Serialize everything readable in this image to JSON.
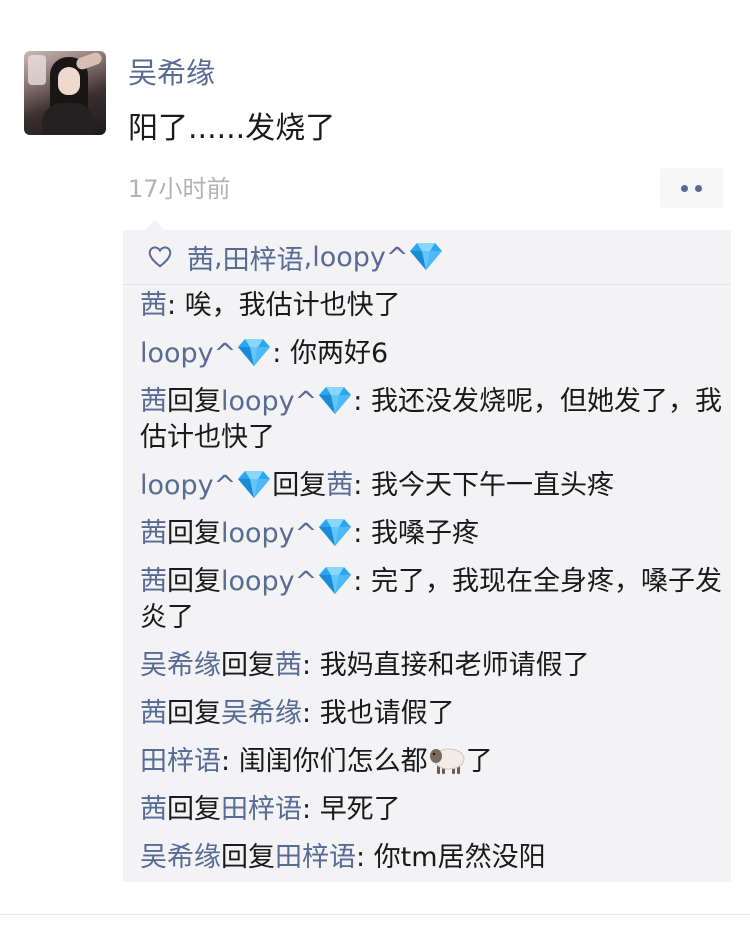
{
  "post": {
    "author": "吴希缘",
    "text": "阳了......发烧了",
    "time": "17小时前",
    "avatar_icon": "user-avatar-photo",
    "more_icon": "more-dots-icon"
  },
  "likes": {
    "icon": "heart-outline-icon",
    "names": [
      "茜",
      "田梓语",
      "loopy^"
    ],
    "separator": ", ",
    "badge_icon": "diamond-emoji"
  },
  "comments": [
    {
      "from": "茜",
      "to": "",
      "text": "唉，我估计也快了",
      "from_badge": false,
      "to_badge": false
    },
    {
      "from": "loopy^",
      "to": "",
      "text": "你两好6",
      "from_badge": true,
      "to_badge": false
    },
    {
      "from": "茜",
      "to": "loopy^",
      "text": "我还没发烧呢，但她发了，我估计也快了",
      "from_badge": false,
      "to_badge": true
    },
    {
      "from": "loopy^",
      "to": "茜",
      "text": "我今天下午一直头疼",
      "from_badge": true,
      "to_badge": false
    },
    {
      "from": "茜",
      "to": "loopy^",
      "text": "我嗓子疼",
      "from_badge": false,
      "to_badge": true
    },
    {
      "from": "茜",
      "to": "loopy^",
      "text": "完了，我现在全身疼，嗓子发炎了",
      "from_badge": false,
      "to_badge": true
    },
    {
      "from": "吴希缘",
      "to": "茜",
      "text": "我妈直接和老师请假了",
      "from_badge": false,
      "to_badge": false
    },
    {
      "from": "茜",
      "to": "吴希缘",
      "text": "我也请假了",
      "from_badge": false,
      "to_badge": false
    },
    {
      "from": "田梓语",
      "to": "",
      "text": "闺闺你们怎么都",
      "text_after": "了",
      "emoji": "sheep-emoji",
      "from_badge": false,
      "to_badge": false
    },
    {
      "from": "茜",
      "to": "田梓语",
      "text": "早死了",
      "from_badge": false,
      "to_badge": false
    },
    {
      "from": "吴希缘",
      "to": "田梓语",
      "text": "你tm居然没阳",
      "from_badge": false,
      "to_badge": false
    }
  ],
  "labels": {
    "reply_word": "回复",
    "colon": ": "
  },
  "colors": {
    "name": "#576b95",
    "text": "#1a1a1a",
    "time": "#b2b2b2",
    "box_bg": "#f3f3f5"
  }
}
